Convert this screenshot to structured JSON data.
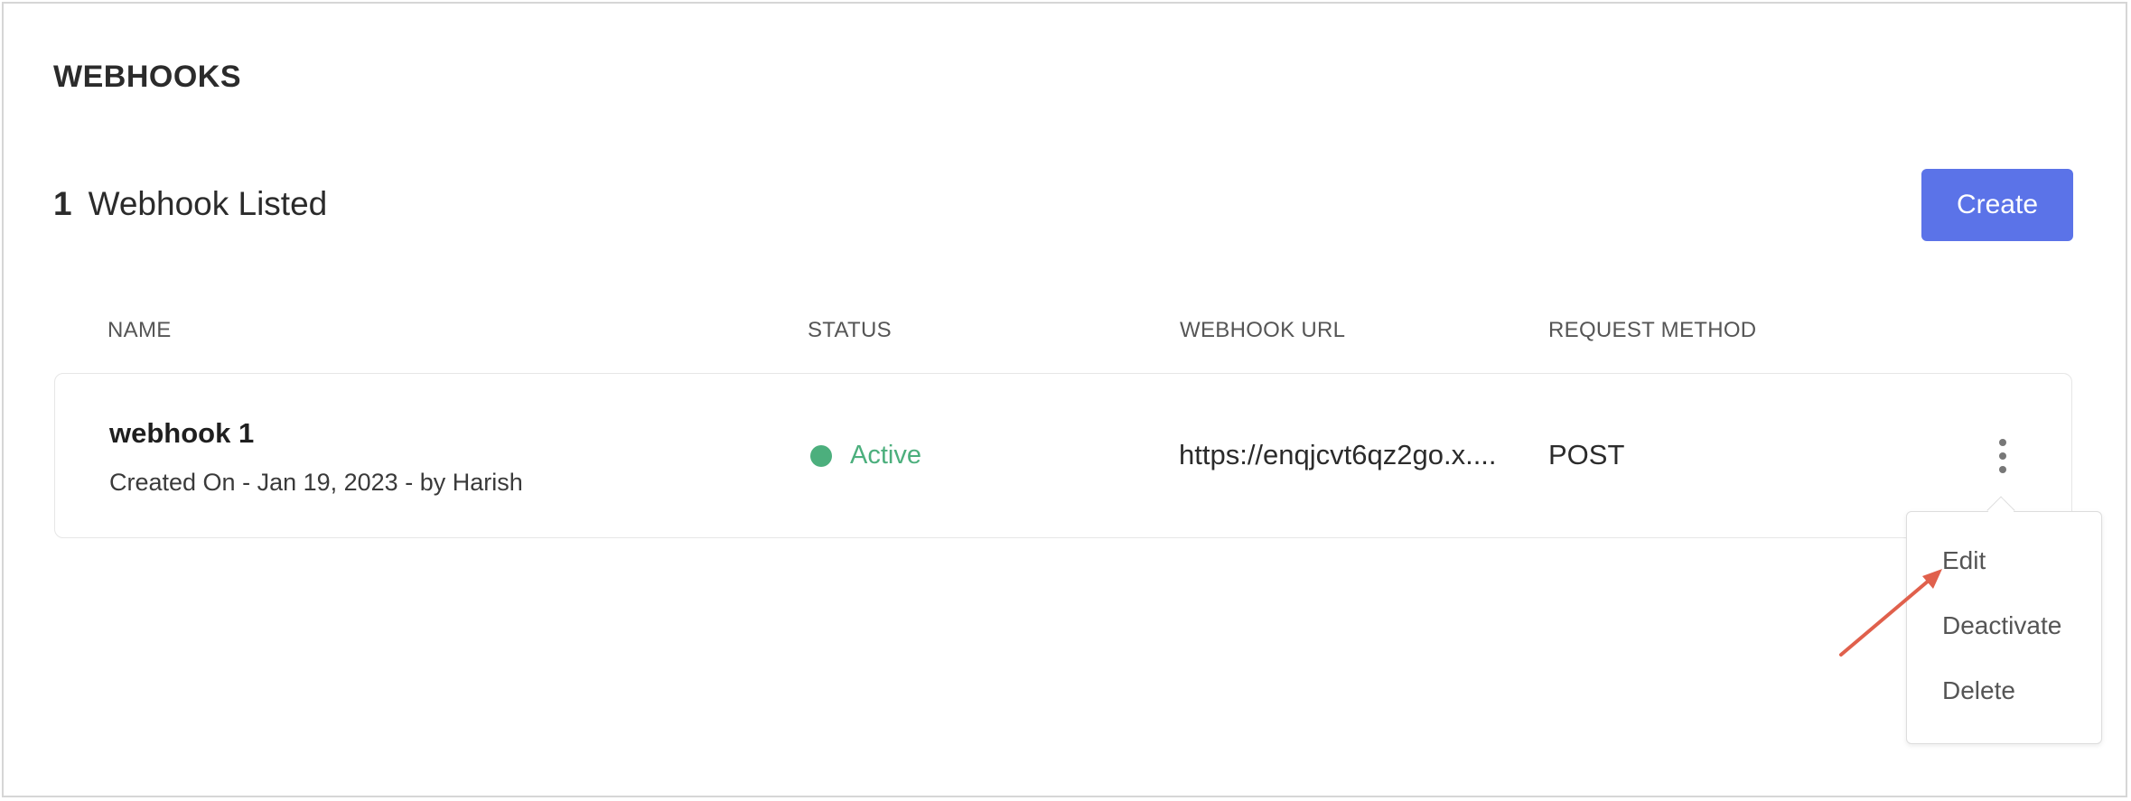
{
  "page": {
    "title": "WEBHOOKS",
    "count": "1",
    "count_label": "Webhook Listed",
    "create_label": "Create"
  },
  "table": {
    "headers": [
      "NAME",
      "STATUS",
      "WEBHOOK URL",
      "REQUEST METHOD"
    ],
    "rows": [
      {
        "name": "webhook 1",
        "meta": "Created On - Jan 19, 2023 - by Harish",
        "status": "Active",
        "url": "https://enqjcvt6qz2go.x....",
        "method": "POST"
      }
    ]
  },
  "row_menu": {
    "items": [
      "Edit",
      "Deactivate",
      "Delete"
    ]
  },
  "colors": {
    "accent": "#5b73e8",
    "status_active": "#4caf7d",
    "annotation_arrow": "#e0604c"
  },
  "icons": {
    "row_actions": "kebab-vertical-icon",
    "status": "status-dot-icon",
    "annotation": "red-arrow-annotation"
  }
}
